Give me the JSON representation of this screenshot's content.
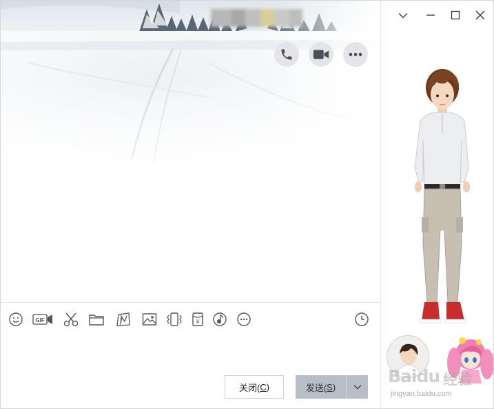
{
  "titlebar": {
    "title_blur_colors": [
      "#b7b7b7",
      "#a8a8a8",
      "#bfbfbf",
      "#d8cf98",
      "#c8c8c8",
      "#bdbdbd"
    ],
    "minimize_menu_icon": "chevron-down-icon",
    "minimize_icon": "minus-icon",
    "maximize_icon": "square-icon",
    "close_icon": "close-icon"
  },
  "header_actions": {
    "call_icon": "phone-icon",
    "video_icon": "video-camera-icon",
    "more_icon": "ellipsis-icon"
  },
  "toolbar": {
    "tools": [
      {
        "name": "emoji",
        "icon": "smiley-icon"
      },
      {
        "name": "gif",
        "icon": "gif-icon",
        "label": "GIF"
      },
      {
        "name": "screenshot",
        "icon": "scissors-icon"
      },
      {
        "name": "file",
        "icon": "folder-icon"
      },
      {
        "name": "doodle",
        "icon": "doodle-icon"
      },
      {
        "name": "image",
        "icon": "image-icon"
      },
      {
        "name": "shake",
        "icon": "vibrate-icon"
      },
      {
        "name": "red-packet",
        "icon": "yuan-icon",
        "label": "¥"
      },
      {
        "name": "music",
        "icon": "music-icon"
      },
      {
        "name": "more",
        "icon": "ellipsis-circle-icon"
      }
    ],
    "history_icon": "clock-icon"
  },
  "footer": {
    "close_label": "关闭(",
    "close_key": "C",
    "close_suffix": ")",
    "send_label": "发送(",
    "send_key": "S",
    "send_suffix": ")",
    "send_dropdown_icon": "chevron-down-icon"
  },
  "watermark": {
    "brand": "Baidu",
    "brand_cn": "经验",
    "url": "jingyan.baidu.com"
  },
  "colors": {
    "send_button_bg": "#b7bec8",
    "action_button_bg": "#e4e4e8",
    "icon_color": "#555555"
  }
}
